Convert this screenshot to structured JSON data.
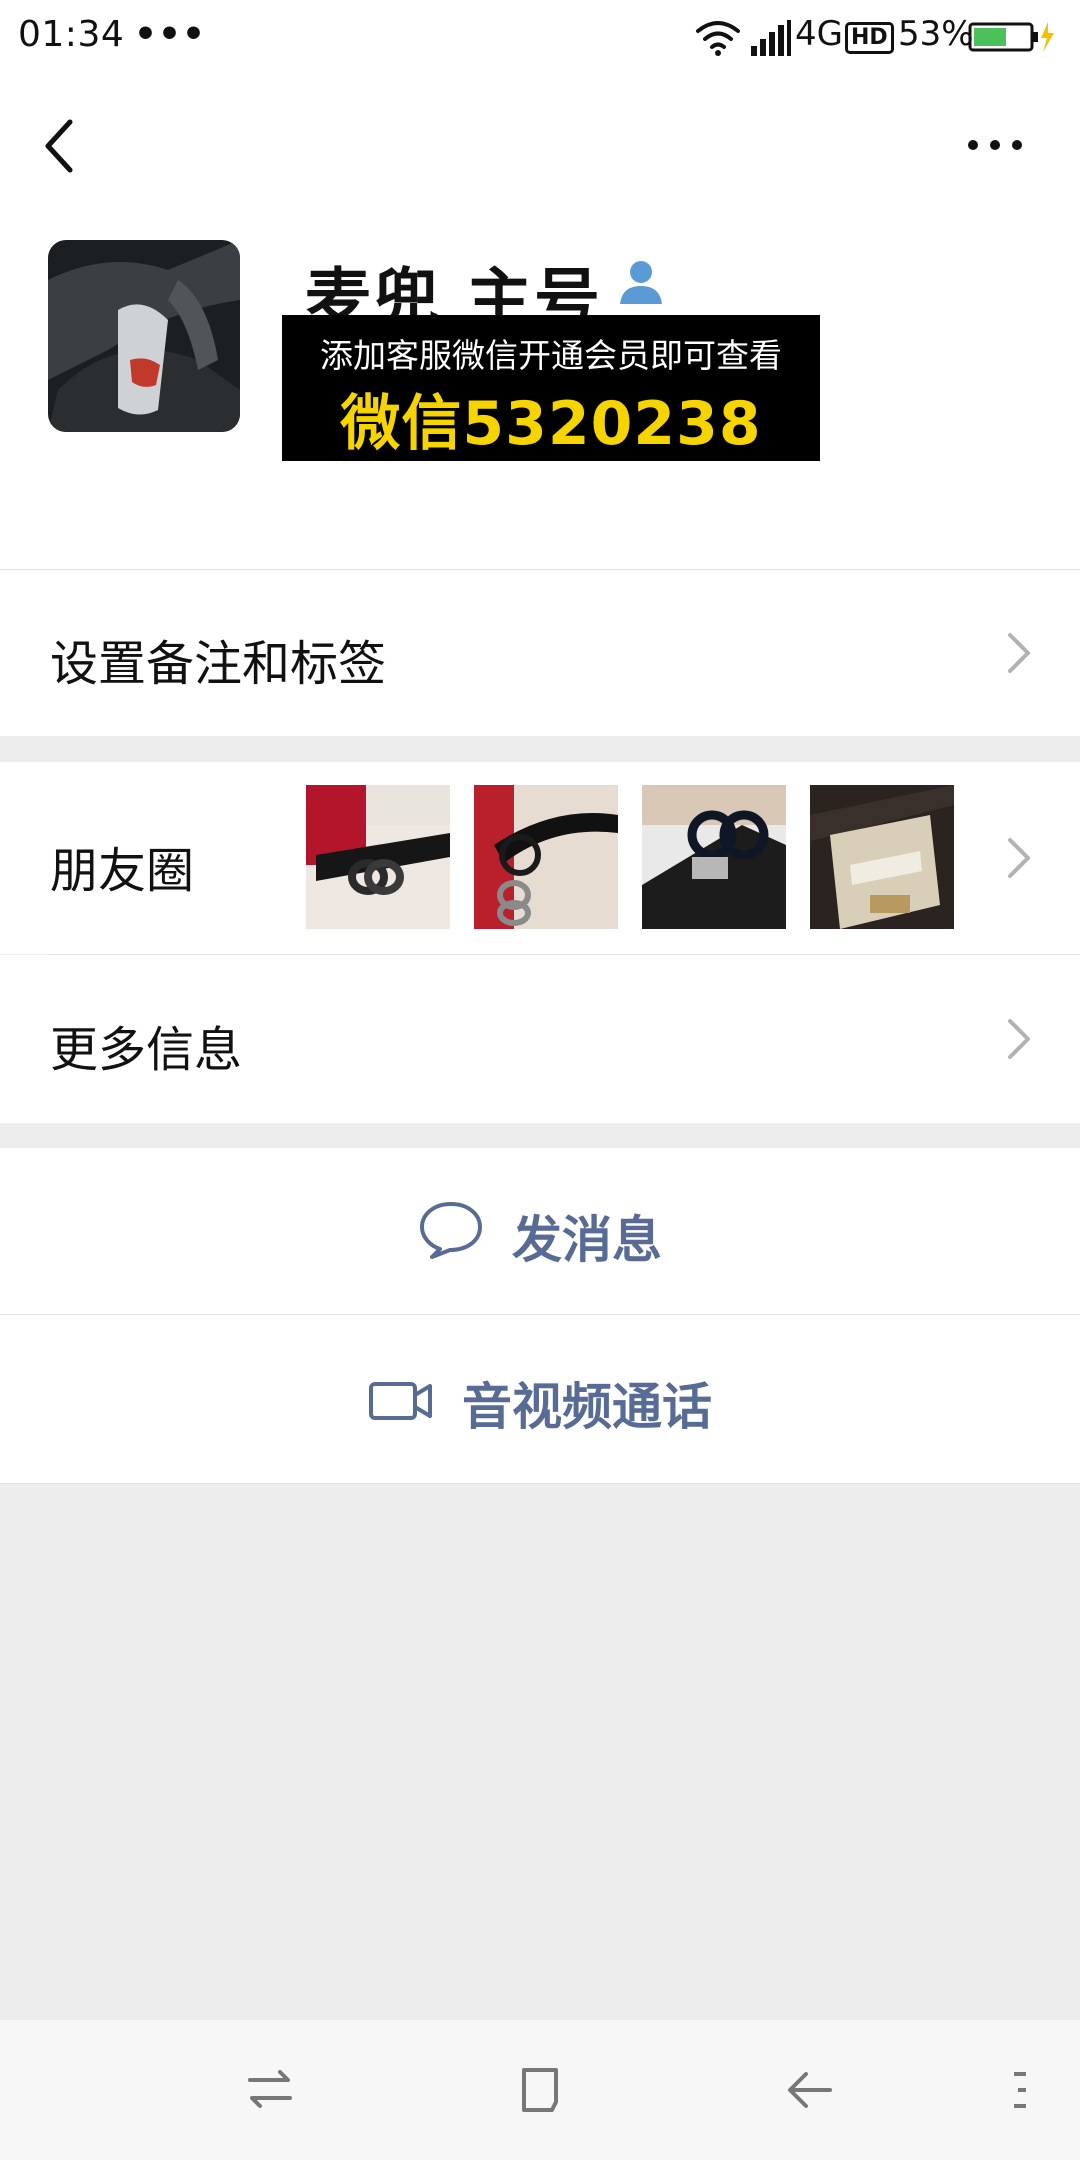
{
  "status_bar": {
    "time": "01:34",
    "dots": "•••",
    "network": "4G",
    "hd": "HD",
    "battery": "53%"
  },
  "header": {
    "display_name": "麦兜 主号",
    "icons": {
      "back": "back-arrow-icon",
      "more": "more-dots-icon",
      "verified": "contact-person-icon"
    }
  },
  "overlay": {
    "line1": "添加客服微信开通会员即可查看",
    "line2": "微信5320238",
    "colors": {
      "bg": "#000000",
      "line1": "#ffffff",
      "line2": "#f5d400"
    }
  },
  "rows": {
    "remark_label": "设置备注和标签",
    "moments_label": "朋友圈",
    "more_info_label": "更多信息"
  },
  "moments_thumbnails": [
    {
      "alt": "belt-photo-1"
    },
    {
      "alt": "belt-photo-2"
    },
    {
      "alt": "belt-photo-3"
    },
    {
      "alt": "belt-photo-4"
    }
  ],
  "actions": {
    "message_label": "发消息",
    "call_label": "音视频通话"
  },
  "colors": {
    "page_bg": "#ededed",
    "card_bg": "#ffffff",
    "link_blue": "#576b95",
    "chevron": "#b2b2b2"
  },
  "nav": {
    "icons": [
      "switch-apps-icon",
      "home-square-icon",
      "back-arrow-icon",
      "menu-icon"
    ]
  }
}
